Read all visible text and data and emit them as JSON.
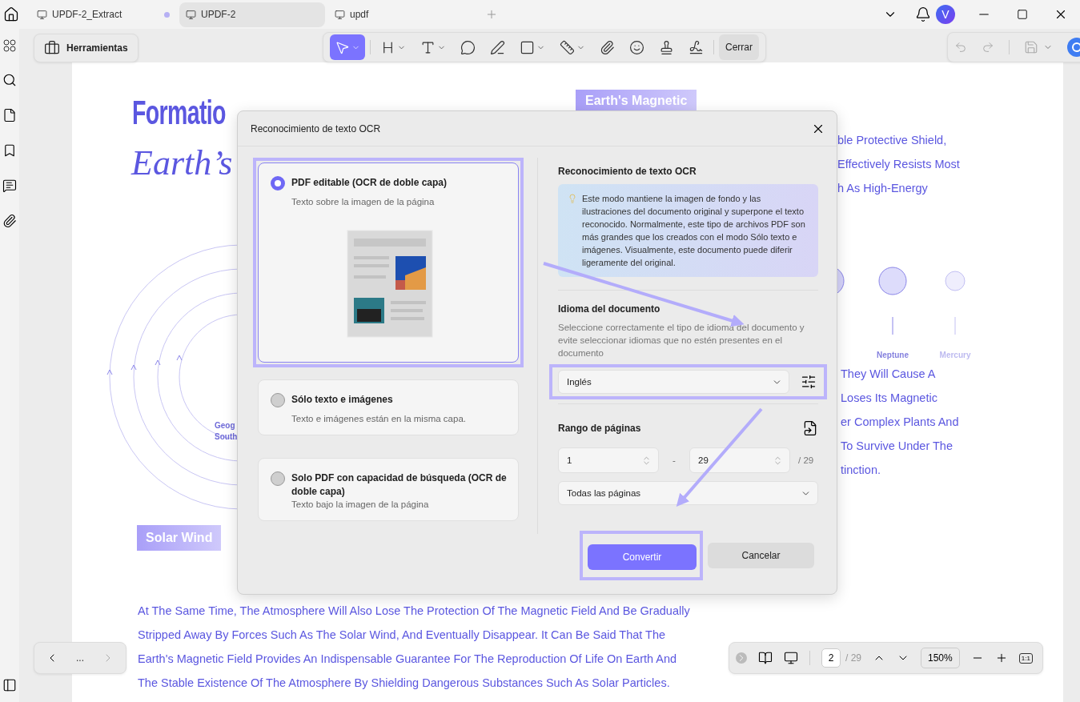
{
  "tabs": [
    {
      "label": "UPDF-2_Extract",
      "selected": false,
      "modified": true
    },
    {
      "label": "UPDF-2",
      "selected": true,
      "modified": false
    },
    {
      "label": "updf",
      "selected": false,
      "modified": false
    }
  ],
  "avatar": "V",
  "tools_button": "Herramientas",
  "tools": [
    {
      "kind": "select",
      "selected": true,
      "menu": true
    },
    {
      "kind": "heading",
      "selected": false,
      "menu": true
    },
    {
      "kind": "text",
      "selected": false,
      "menu": true
    },
    {
      "kind": "comment",
      "selected": false,
      "menu": false
    },
    {
      "kind": "pen",
      "selected": false,
      "menu": false
    },
    {
      "kind": "shape",
      "selected": false,
      "menu": true
    },
    {
      "kind": "measure",
      "selected": false,
      "menu": true
    },
    {
      "kind": "attach",
      "selected": false,
      "menu": false
    },
    {
      "kind": "sticker",
      "selected": false,
      "menu": false
    },
    {
      "kind": "stamp",
      "selected": false,
      "menu": false
    },
    {
      "kind": "signature",
      "selected": false,
      "menu": false
    }
  ],
  "close_tools": "Cerrar",
  "document": {
    "title": "Formatio",
    "subtitle": "Earth’s",
    "tag": "Earth's Magnetic",
    "diagram_labels": [
      "Geog",
      "South"
    ],
    "section_tag": "Solar Wind",
    "right_lines_top": [
      "ble Protective Shield,",
      "Effectively Resists Most",
      "h As High-Energy"
    ],
    "planets": [
      {
        "name": "Neptune",
        "faded": false
      },
      {
        "name": "Mercury",
        "faded": true
      }
    ],
    "right_lines_bottom": [
      "They Will Cause A",
      "Loses Its Magnetic",
      "er Complex Plants And",
      "To Survive Under The",
      "tinction."
    ],
    "paragraph_lines": [
      "At The Same Time, The Atmosphere Will Also Lose The Protection Of The Magnetic Field And Be Gradually",
      "Stripped Away By Forces Such As The Solar Wind, And Eventually Disappear. It Can Be Said That The",
      "Earth's Magnetic Field Provides An Indispensable Guarantee For The Reproduction Of Life On Earth And",
      "The Stable Existence Of The Atmosphere By Shielding Dangerous Substances Such As Solar Particles."
    ]
  },
  "dialog": {
    "title": "Reconocimiento de texto OCR",
    "options": [
      {
        "title": "PDF editable (OCR de doble capa)",
        "description": "Texto sobre la imagen de la página",
        "selected": true,
        "highlighted": true
      },
      {
        "title": "Sólo texto e imágenes",
        "description": "Texto e imágenes están en la misma capa.",
        "selected": false,
        "highlighted": false
      },
      {
        "title": "Solo PDF con capacidad de búsqueda (OCR de doble capa)",
        "description": "Texto bajo la imagen de la página",
        "selected": false,
        "highlighted": false
      }
    ],
    "info": {
      "heading": "Reconocimiento de texto OCR",
      "text": "Este modo mantiene la imagen de fondo y las ilustraciones del documento original y superpone el texto reconocido. Normalmente, este tipo de archivos PDF son más grandes que los creados con el modo Sólo texto e imágenes. Visualmente, este documento puede diferir ligeramente del original."
    },
    "language": {
      "heading": "Idioma del documento",
      "hint": "Seleccione correctamente el tipo de idioma del documento y evite seleccionar idiomas que no estén presentes en el documento",
      "value": "Inglés",
      "highlighted": true
    },
    "range": {
      "heading": "Rango de páginas",
      "from": "1",
      "separator": "-",
      "to": "29",
      "total": "/ 29",
      "scope": "Todas las páginas"
    },
    "buttons": [
      {
        "label": "Convertir",
        "kind": "primary",
        "highlighted": true
      },
      {
        "label": "Cancelar",
        "kind": "secondary",
        "highlighted": false
      }
    ]
  },
  "pager": {
    "more": "...",
    "page": "2",
    "total": "/ 29",
    "zoom": "150%",
    "fit": "1:1"
  }
}
